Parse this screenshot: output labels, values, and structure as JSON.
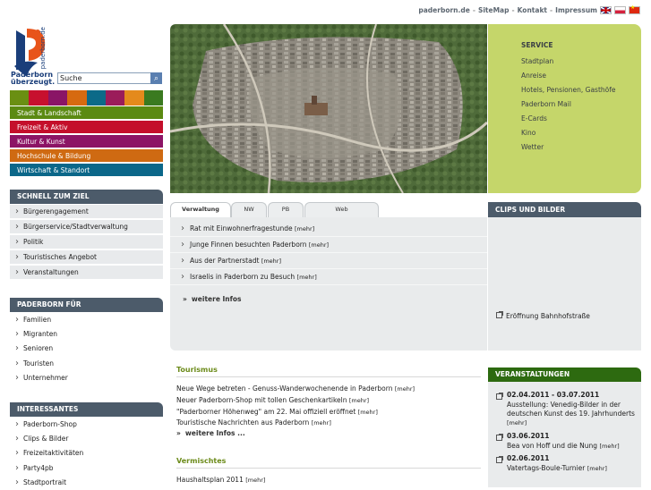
{
  "toplinks": {
    "domain": "paderborn.de",
    "sitemap": "SiteMap",
    "kontakt": "Kontakt",
    "impressum": "Impressum",
    "sep": "-"
  },
  "logo": {
    "vertical": "paderborn.de",
    "line1": "Paderborn",
    "line2": "überzeugt."
  },
  "search": {
    "value": "Suche"
  },
  "strip_colors": [
    "#6a8f12",
    "#c7102e",
    "#8a1566",
    "#d66a10",
    "#0c6a88",
    "#9b1c5a",
    "#e48a1c",
    "#3a7a20"
  ],
  "categories": [
    {
      "label": "Stadt & Landschaft",
      "color": "#5b8a12"
    },
    {
      "label": "Freizeit & Aktiv",
      "color": "#c40f2b"
    },
    {
      "label": "Kultur & Kunst",
      "color": "#8c1465"
    },
    {
      "label": "Hochschule & Bildung",
      "color": "#cf6a12"
    },
    {
      "label": "Wirtschaft & Standort",
      "color": "#0b6789"
    }
  ],
  "schnell": {
    "title": "SCHNELL ZUM ZIEL",
    "items": [
      "Bürgerengagement",
      "Bürgerservice/Stadtverwaltung",
      "Politik",
      "Touristisches Angebot",
      "Veranstaltungen"
    ]
  },
  "paderborn_fuer": {
    "title": "PADERBORN FÜR",
    "items": [
      "Familien",
      "Migranten",
      "Senioren",
      "Touristen",
      "Unternehmer"
    ]
  },
  "interessantes": {
    "title": "INTERESSANTES",
    "items": [
      "Paderborn-Shop",
      "Clips & Bilder",
      "Freizeitaktivitäten",
      "Party4pb",
      "Stadtportrait"
    ]
  },
  "service": {
    "title": "SERVICE",
    "items": [
      "Stadtplan",
      "Anreise",
      "Hotels, Pensionen, Gasthöfe",
      "Paderborn Mail",
      "E-Cards",
      "Kino",
      "Wetter"
    ]
  },
  "tabs": [
    "Verwaltung",
    "NW",
    "PB",
    "Web"
  ],
  "news": {
    "mehr": "[mehr]",
    "items": [
      "Rat mit Einwohnerfragestunde",
      "Junge Finnen besuchten Paderborn",
      "Aus der Partnerstadt",
      "Israelis in Paderborn zu Besuch"
    ],
    "more": "weitere Infos"
  },
  "clips": {
    "title": "CLIPS UND BILDER",
    "item": "Eröffnung Bahnhofstraße"
  },
  "tourismus": {
    "title": "Tourismus",
    "lines": [
      "Neue Wege betreten - Genuss-Wanderwochenende in Paderborn",
      "Neuer Paderborn-Shop mit tollen Geschenkartikeln",
      "\"Paderborner Höhenweg\" am 22. Mai offiziell eröffnet",
      "Touristische Nachrichten aus Paderborn"
    ],
    "more": "weitere Infos ..."
  },
  "vermischtes": {
    "title": "Vermischtes",
    "lines": [
      "Haushaltsplan 2011"
    ]
  },
  "veranstaltungen": {
    "title": "VERANSTALTUNGEN",
    "events": [
      {
        "date": "02.04.2011 - 03.07.2011",
        "text": "Ausstellung: Venedig-Bilder in der deutschen Kunst des 19. Jahrhunderts",
        "mehr": "[mehr]"
      },
      {
        "date": "03.06.2011",
        "text": "Bea von Hoff und die Nung",
        "mehr": "[mehr]"
      },
      {
        "date": "02.06.2011",
        "text": "Vatertags-Boule-Turnier",
        "mehr": "[mehr]"
      }
    ]
  }
}
